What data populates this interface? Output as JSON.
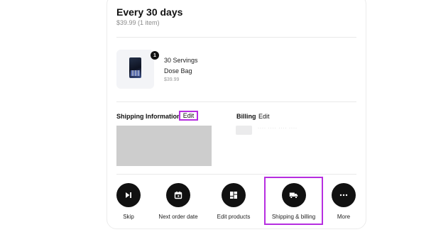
{
  "subscription": {
    "frequency_title": "Every 30 days",
    "summary": "$39.99 (1 item)"
  },
  "product": {
    "quantity": "1",
    "name_line1": "30 Servings",
    "name_line2": "Dose Bag",
    "price": "$39.99"
  },
  "shipping": {
    "label": "Shipping Information",
    "edit_label": "Edit"
  },
  "billing": {
    "label": "Billing",
    "edit_label": "Edit",
    "card_mask": "···· ···· ···· ····"
  },
  "actions": [
    {
      "label": "Skip",
      "icon": "skip-icon"
    },
    {
      "label": "Next order date",
      "icon": "calendar-icon"
    },
    {
      "label": "Edit products",
      "icon": "grid-icon"
    },
    {
      "label": "Shipping & billing",
      "icon": "truck-icon"
    },
    {
      "label": "More",
      "icon": "more-icon"
    }
  ],
  "colors": {
    "highlight": "#b62ee0",
    "action_bg": "#111111",
    "placeholder": "#cdcdcd"
  }
}
